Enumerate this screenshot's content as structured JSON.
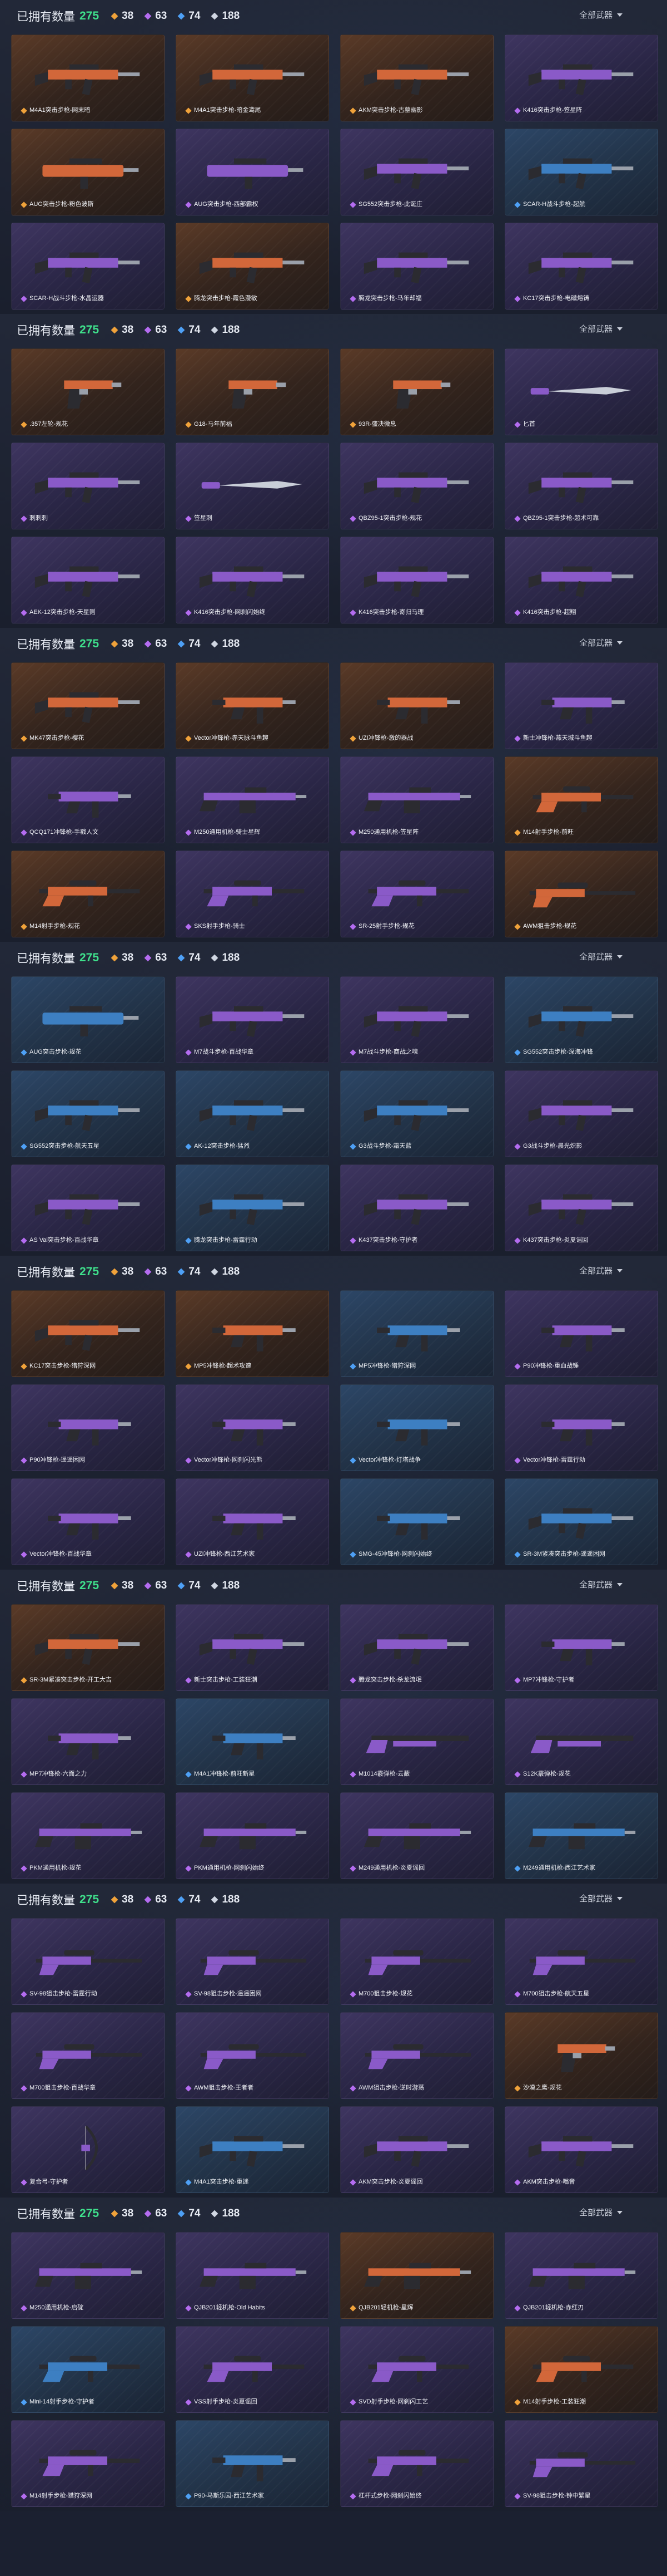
{
  "header": {
    "title": "已拥有数量",
    "total": "275",
    "counts": [
      "38",
      "63",
      "74",
      "188"
    ],
    "filter_label": "全部武器"
  },
  "colors": {
    "orange": "#f0a23a",
    "purple": "#b46cf0",
    "blue": "#4ea0f5",
    "green": "#3fe08c"
  },
  "sections": [
    {
      "cards": [
        {
          "name": "M4A1突击步枪-网末暗",
          "rarity": "orange",
          "kind": "rifle"
        },
        {
          "name": "M4A1突击步枪-暗金鸢尾",
          "rarity": "orange",
          "kind": "rifle"
        },
        {
          "name": "AKM突击步枪-古墓幽影",
          "rarity": "orange",
          "kind": "rifle"
        },
        {
          "name": "K416突击步枪-笠星阵",
          "rarity": "purple",
          "kind": "rifle"
        },
        {
          "name": "AUG突击步枪-粉色波斯",
          "rarity": "orange",
          "kind": "bullpup"
        },
        {
          "name": "AUG突击步枪-西部霸权",
          "rarity": "purple",
          "kind": "bullpup"
        },
        {
          "name": "SG552突击步枪-此诞庄",
          "rarity": "purple",
          "kind": "rifle"
        },
        {
          "name": "SCAR-H战斗步枪-起航",
          "rarity": "blue",
          "kind": "rifle"
        },
        {
          "name": "SCAR-H战斗步枪-水晶运器",
          "rarity": "purple",
          "kind": "rifle"
        },
        {
          "name": "腾龙突击步枪-霞色漫敏",
          "rarity": "orange",
          "kind": "rifle"
        },
        {
          "name": "腾龙突击步枪-马年却福",
          "rarity": "purple",
          "kind": "rifle"
        },
        {
          "name": "KC17突击步枪-电磁熔铸",
          "rarity": "purple",
          "kind": "rifle"
        }
      ]
    },
    {
      "cards": [
        {
          "name": ".357左轮-规花",
          "rarity": "orange",
          "kind": "pistol"
        },
        {
          "name": "G18-马年前福",
          "rarity": "orange",
          "kind": "pistol"
        },
        {
          "name": "93R-盛决微息",
          "rarity": "orange",
          "kind": "pistol"
        },
        {
          "name": "匕首",
          "rarity": "purple",
          "kind": "knife"
        },
        {
          "name": "刺刺刺",
          "rarity": "purple",
          "kind": "rifle"
        },
        {
          "name": "笠星刺",
          "rarity": "purple",
          "kind": "knife"
        },
        {
          "name": "QBZ95-1突击步枪-规花",
          "rarity": "purple",
          "kind": "rifle"
        },
        {
          "name": "QBZ95-1突击步枪-超术可靠",
          "rarity": "purple",
          "kind": "rifle"
        },
        {
          "name": "AEK-12突击步枪-天星则",
          "rarity": "purple",
          "kind": "rifle"
        },
        {
          "name": "K416突击步枪-网刹闪始终",
          "rarity": "purple",
          "kind": "rifle"
        },
        {
          "name": "K416突击步枪-寄归马理",
          "rarity": "purple",
          "kind": "rifle"
        },
        {
          "name": "K416突击步枪-超翔",
          "rarity": "purple",
          "kind": "rifle"
        }
      ]
    },
    {
      "cards": [
        {
          "name": "MK47突击步枪-樱花",
          "rarity": "orange",
          "kind": "rifle"
        },
        {
          "name": "Vector冲锋枪-赤天脉斗鱼趣",
          "rarity": "orange",
          "kind": "smg"
        },
        {
          "name": "UZI冲锋枪-激的器战",
          "rarity": "orange",
          "kind": "smg"
        },
        {
          "name": "新士冲锋枪-燕天城斗鱼趣",
          "rarity": "purple",
          "kind": "smg"
        },
        {
          "name": "QCQ171冲锋枪-手戳人文",
          "rarity": "purple",
          "kind": "smg"
        },
        {
          "name": "M250通用机枪-骑士星辉",
          "rarity": "purple",
          "kind": "lmg"
        },
        {
          "name": "M250通用机枪-笠星阵",
          "rarity": "purple",
          "kind": "lmg"
        },
        {
          "name": "M14射手步枪-前旺",
          "rarity": "orange",
          "kind": "dmr"
        },
        {
          "name": "M14射手步枪-规花",
          "rarity": "orange",
          "kind": "dmr"
        },
        {
          "name": "SKS射手步枪-骑士",
          "rarity": "purple",
          "kind": "dmr"
        },
        {
          "name": "SR-25射手步枪-规花",
          "rarity": "purple",
          "kind": "dmr"
        },
        {
          "name": "AWM狙击步枪-规花",
          "rarity": "orange",
          "kind": "sniper"
        }
      ]
    },
    {
      "cards": [
        {
          "name": "AUG突击步枪-规花",
          "rarity": "blue",
          "kind": "bullpup"
        },
        {
          "name": "M7战斗步枪-百战华章",
          "rarity": "purple",
          "kind": "rifle"
        },
        {
          "name": "M7战斗步枪-商战之魂",
          "rarity": "purple",
          "kind": "rifle"
        },
        {
          "name": "SG552突击步枪-深海冲锋",
          "rarity": "blue",
          "kind": "rifle"
        },
        {
          "name": "SG552突击步枪-航天五星",
          "rarity": "blue",
          "kind": "rifle"
        },
        {
          "name": "AK-12突击步枪-猛烈",
          "rarity": "blue",
          "kind": "rifle"
        },
        {
          "name": "G3战斗步枪-霜天蓝",
          "rarity": "blue",
          "kind": "rifle"
        },
        {
          "name": "G3战斗步枪-晨光炽影",
          "rarity": "purple",
          "kind": "rifle"
        },
        {
          "name": "AS Val突击步枪-百战华章",
          "rarity": "purple",
          "kind": "rifle"
        },
        {
          "name": "腾龙突击步枪-雷霆行动",
          "rarity": "blue",
          "kind": "rifle"
        },
        {
          "name": "K437突击步枪-守护者",
          "rarity": "purple",
          "kind": "rifle"
        },
        {
          "name": "K437突击步枪-炎夏谣回",
          "rarity": "purple",
          "kind": "rifle"
        }
      ]
    },
    {
      "cards": [
        {
          "name": "KC17突击步枪-猎狩深网",
          "rarity": "orange",
          "kind": "rifle"
        },
        {
          "name": "MP5冲锋枪-超术攻速",
          "rarity": "orange",
          "kind": "smg"
        },
        {
          "name": "MP5冲锋枪-猎狩深网",
          "rarity": "blue",
          "kind": "smg"
        },
        {
          "name": "P90冲锋枪-重血战锤",
          "rarity": "purple",
          "kind": "smg"
        },
        {
          "name": "P90冲锋枪-遥遥困网",
          "rarity": "purple",
          "kind": "smg"
        },
        {
          "name": "Vector冲锋枪-网刹闪光熊",
          "rarity": "purple",
          "kind": "smg"
        },
        {
          "name": "Vector冲锋枪-灯塔战争",
          "rarity": "blue",
          "kind": "smg"
        },
        {
          "name": "Vector冲锋枪-雷霆行动",
          "rarity": "purple",
          "kind": "smg"
        },
        {
          "name": "Vector冲锋枪-百战华章",
          "rarity": "purple",
          "kind": "smg"
        },
        {
          "name": "UZI冲锋枪-西江艺术家",
          "rarity": "purple",
          "kind": "smg"
        },
        {
          "name": "SMG-45冲锋枪-网刹闪始终",
          "rarity": "blue",
          "kind": "smg"
        },
        {
          "name": "SR-3M紧凑突击步枪-遥遥困网",
          "rarity": "blue",
          "kind": "rifle"
        }
      ]
    },
    {
      "cards": [
        {
          "name": "SR-3M紧凑突击步枪-开工大吉",
          "rarity": "orange",
          "kind": "rifle"
        },
        {
          "name": "新士突击步枪-工装狂潮",
          "rarity": "purple",
          "kind": "rifle"
        },
        {
          "name": "腾龙突击步枪-杀龙流氓",
          "rarity": "purple",
          "kind": "rifle"
        },
        {
          "name": "MP7冲锋枪-守护者",
          "rarity": "purple",
          "kind": "smg"
        },
        {
          "name": "MP7冲锋枪-六面之力",
          "rarity": "purple",
          "kind": "smg"
        },
        {
          "name": "M4A1冲锋枪-前旺新星",
          "rarity": "blue",
          "kind": "smg"
        },
        {
          "name": "M1014霰弹枪-云蔽",
          "rarity": "purple",
          "kind": "shotgun"
        },
        {
          "name": "S12K霰弹枪-规花",
          "rarity": "purple",
          "kind": "shotgun"
        },
        {
          "name": "PKM通用机枪-规花",
          "rarity": "purple",
          "kind": "lmg"
        },
        {
          "name": "PKM通用机枪-网刹闪始终",
          "rarity": "purple",
          "kind": "lmg"
        },
        {
          "name": "M249通用机枪-炎夏谣回",
          "rarity": "purple",
          "kind": "lmg"
        },
        {
          "name": "M249通用机枪-西江艺术家",
          "rarity": "blue",
          "kind": "lmg"
        }
      ]
    },
    {
      "cards": [
        {
          "name": "SV-98狙击步枪-雷霆行动",
          "rarity": "purple",
          "kind": "sniper"
        },
        {
          "name": "SV-98狙击步枪-遥遥困网",
          "rarity": "purple",
          "kind": "sniper"
        },
        {
          "name": "M700狙击步枪-规花",
          "rarity": "purple",
          "kind": "sniper"
        },
        {
          "name": "M700狙击步枪-航天五星",
          "rarity": "purple",
          "kind": "sniper"
        },
        {
          "name": "M700狙击步枪-百战华章",
          "rarity": "purple",
          "kind": "sniper"
        },
        {
          "name": "AWM狙击步枪-王者者",
          "rarity": "purple",
          "kind": "sniper"
        },
        {
          "name": "AWM狙击步枪-逆时游荡",
          "rarity": "purple",
          "kind": "sniper"
        },
        {
          "name": "沙漠之鹰-规花",
          "rarity": "orange",
          "kind": "pistol"
        },
        {
          "name": "复合弓-守护者",
          "rarity": "purple",
          "kind": "bow"
        },
        {
          "name": "M4A1突击步枪-重迷",
          "rarity": "blue",
          "kind": "rifle"
        },
        {
          "name": "AKM突击步枪-炎夏谣回",
          "rarity": "purple",
          "kind": "rifle"
        },
        {
          "name": "AKM突击步枪-嗡音",
          "rarity": "purple",
          "kind": "rifle"
        }
      ]
    },
    {
      "cards": [
        {
          "name": "M250通用机枪-启碇",
          "rarity": "purple",
          "kind": "lmg"
        },
        {
          "name": "QJB201轻机枪-Old Habits",
          "rarity": "purple",
          "kind": "lmg"
        },
        {
          "name": "QJB201轻机枪-星辉",
          "rarity": "orange",
          "kind": "lmg"
        },
        {
          "name": "QJB201轻机枪-赤红刃",
          "rarity": "purple",
          "kind": "lmg"
        },
        {
          "name": "Mini-14射手步枪-守护者",
          "rarity": "blue",
          "kind": "dmr"
        },
        {
          "name": "VSS射手步枪-炎夏谣回",
          "rarity": "purple",
          "kind": "dmr"
        },
        {
          "name": "SVD射手步枪-网刹闪工艺",
          "rarity": "purple",
          "kind": "dmr"
        },
        {
          "name": "M14射手步枪-工装狂潮",
          "rarity": "orange",
          "kind": "dmr"
        },
        {
          "name": "M14射手步枪-猎狩深网",
          "rarity": "purple",
          "kind": "dmr"
        },
        {
          "name": "P90-马斯乐园-西江艺术家",
          "rarity": "blue",
          "kind": "smg"
        },
        {
          "name": "杠杆式步枪-网刹闪始终",
          "rarity": "purple",
          "kind": "dmr"
        },
        {
          "name": "SV-98狙击步枪-钟中繁星",
          "rarity": "purple",
          "kind": "sniper"
        }
      ]
    }
  ]
}
